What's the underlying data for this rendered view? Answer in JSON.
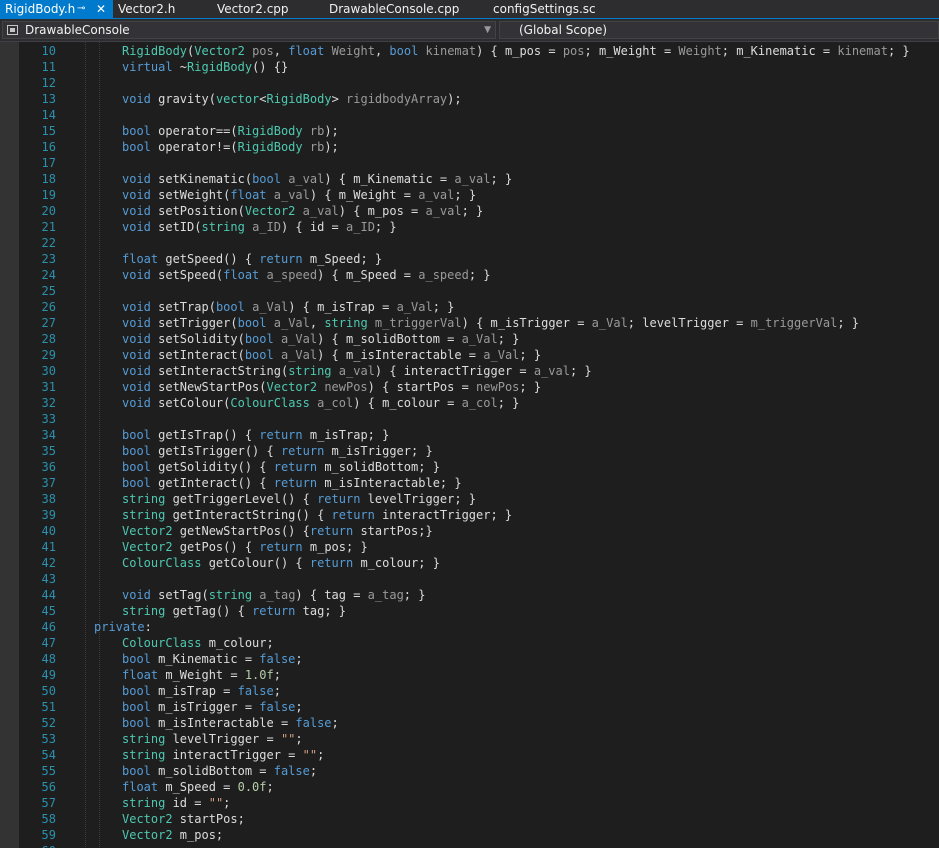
{
  "tabs": [
    {
      "label": "RigidBody.h",
      "active": true
    },
    {
      "label": "Vector2.h",
      "active": false
    },
    {
      "label": "Vector2.cpp",
      "active": false
    },
    {
      "label": "DrawableConsole.cpp",
      "active": false
    },
    {
      "label": "configSettings.sc",
      "active": false
    }
  ],
  "tab_icons": {
    "pin": "pin-icon",
    "close": "close-icon"
  },
  "navigation": {
    "project": "DrawableConsole",
    "scope": "(Global Scope)"
  },
  "colors": {
    "keyword": "#569cd6",
    "type": "#4ec9b0",
    "parameter": "#9a9a9a",
    "number": "#b5cea8",
    "string": "#d69d85",
    "line_number": "#2b91af",
    "accent": "#007acc",
    "background": "#1e1e1e"
  },
  "code_lines": [
    {
      "n": "10",
      "text": "    RigidBody(Vector2 pos, float Weight, bool kinemat) { m_pos = pos; m_Weight = Weight; m_Kinematic = kinemat; }"
    },
    {
      "n": "11",
      "text": "    virtual ~RigidBody() {}"
    },
    {
      "n": "12",
      "text": ""
    },
    {
      "n": "13",
      "text": "    void gravity(vector<RigidBody> rigidbodyArray);"
    },
    {
      "n": "14",
      "text": ""
    },
    {
      "n": "15",
      "text": "    bool operator==(RigidBody rb);"
    },
    {
      "n": "16",
      "text": "    bool operator!=(RigidBody rb);"
    },
    {
      "n": "17",
      "text": ""
    },
    {
      "n": "18",
      "text": "    void setKinematic(bool a_val) { m_Kinematic = a_val; }"
    },
    {
      "n": "19",
      "text": "    void setWeight(float a_val) { m_Weight = a_val; }"
    },
    {
      "n": "20",
      "text": "    void setPosition(Vector2 a_val) { m_pos = a_val; }"
    },
    {
      "n": "21",
      "text": "    void setID(string a_ID) { id = a_ID; }"
    },
    {
      "n": "22",
      "text": ""
    },
    {
      "n": "23",
      "text": "    float getSpeed() { return m_Speed; }"
    },
    {
      "n": "24",
      "text": "    void setSpeed(float a_speed) { m_Speed = a_speed; }"
    },
    {
      "n": "25",
      "text": ""
    },
    {
      "n": "26",
      "text": "    void setTrap(bool a_Val) { m_isTrap = a_Val; }"
    },
    {
      "n": "27",
      "text": "    void setTrigger(bool a_Val, string m_triggerVal) { m_isTrigger = a_Val; levelTrigger = m_triggerVal; }"
    },
    {
      "n": "28",
      "text": "    void setSolidity(bool a_Val) { m_solidBottom = a_Val; }"
    },
    {
      "n": "29",
      "text": "    void setInteract(bool a_Val) { m_isInteractable = a_Val; }"
    },
    {
      "n": "30",
      "text": "    void setInteractString(string a_val) { interactTrigger = a_val; }"
    },
    {
      "n": "31",
      "text": "    void setNewStartPos(Vector2 newPos) { startPos = newPos; }"
    },
    {
      "n": "32",
      "text": "    void setColour(ColourClass a_col) { m_colour = a_col; }"
    },
    {
      "n": "33",
      "text": ""
    },
    {
      "n": "34",
      "text": "    bool getIsTrap() { return m_isTrap; }"
    },
    {
      "n": "35",
      "text": "    bool getIsTrigger() { return m_isTrigger; }"
    },
    {
      "n": "36",
      "text": "    bool getSolidity() { return m_solidBottom; }"
    },
    {
      "n": "37",
      "text": "    bool getInteract() { return m_isInteractable; }"
    },
    {
      "n": "38",
      "text": "    string getTriggerLevel() { return levelTrigger; }"
    },
    {
      "n": "39",
      "text": "    string getInteractString() { return interactTrigger; }"
    },
    {
      "n": "40",
      "text": "    Vector2 getNewStartPos() {return startPos;}"
    },
    {
      "n": "41",
      "text": "    Vector2 getPos() { return m_pos; }"
    },
    {
      "n": "42",
      "text": "    ColourClass getColour() { return m_colour; }"
    },
    {
      "n": "43",
      "text": ""
    },
    {
      "n": "44",
      "text": "    void setTag(string a_tag) { tag = a_tag; }"
    },
    {
      "n": "45",
      "text": "    string getTag() { return tag; }"
    },
    {
      "n": "46",
      "text": "private:"
    },
    {
      "n": "47",
      "text": "    ColourClass m_colour;"
    },
    {
      "n": "48",
      "text": "    bool m_Kinematic = false;"
    },
    {
      "n": "49",
      "text": "    float m_Weight = 1.0f;"
    },
    {
      "n": "50",
      "text": "    bool m_isTrap = false;"
    },
    {
      "n": "51",
      "text": "    bool m_isTrigger = false;"
    },
    {
      "n": "52",
      "text": "    bool m_isInteractable = false;"
    },
    {
      "n": "53",
      "text": "    string levelTrigger = \"\";"
    },
    {
      "n": "54",
      "text": "    string interactTrigger = \"\";"
    },
    {
      "n": "55",
      "text": "    bool m_solidBottom = false;"
    },
    {
      "n": "56",
      "text": "    float m_Speed = 0.0f;"
    },
    {
      "n": "57",
      "text": "    string id = \"\";"
    },
    {
      "n": "58",
      "text": "    Vector2 startPos;"
    },
    {
      "n": "59",
      "text": "    Vector2 m_pos;"
    },
    {
      "n": "60",
      "text": ""
    }
  ]
}
